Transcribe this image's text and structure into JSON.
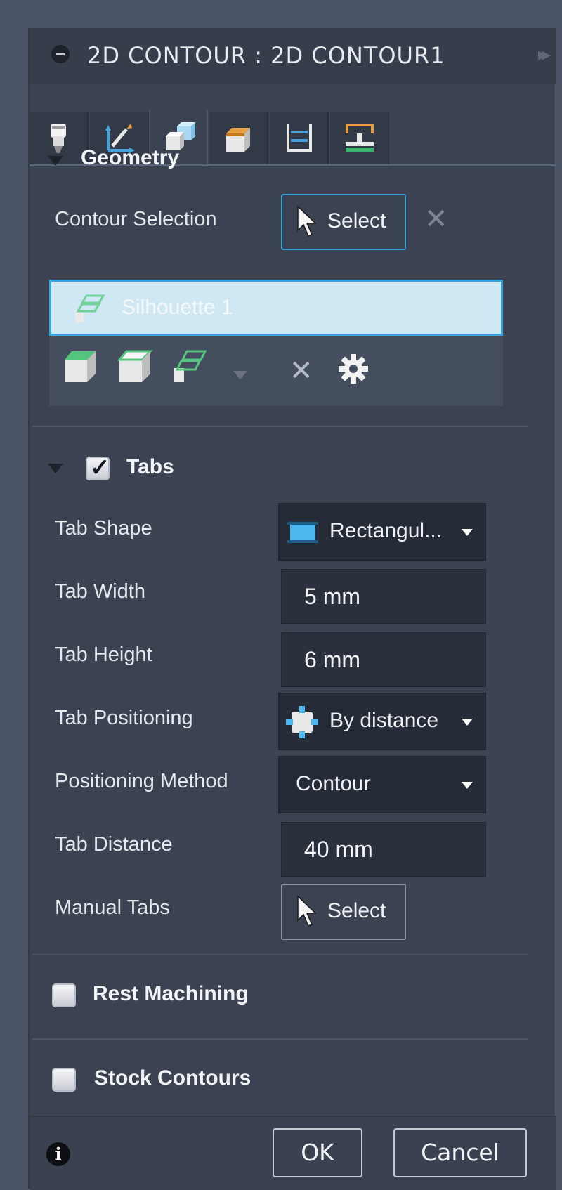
{
  "window": {
    "title": "2D CONTOUR : 2D CONTOUR1"
  },
  "tabs": [
    {
      "name": "tool-tab",
      "icon": "tool-icon"
    },
    {
      "name": "heights-tab",
      "icon": "axes-pencil-icon"
    },
    {
      "name": "geometry-tab",
      "icon": "geometry-cube-icon"
    },
    {
      "name": "stock-tab",
      "icon": "stock-cube-icon"
    },
    {
      "name": "passes-tab",
      "icon": "passes-icon"
    },
    {
      "name": "linking-tab",
      "icon": "linking-icon"
    }
  ],
  "geometry": {
    "title": "Geometry",
    "contour_selection_label": "Contour Selection",
    "select_label": "Select",
    "selected_item": "Silhouette 1"
  },
  "tabs_section": {
    "title": "Tabs",
    "enabled": true,
    "tab_shape_label": "Tab Shape",
    "tab_shape_value": "Rectangul...",
    "tab_width_label": "Tab Width",
    "tab_width_value": "5 mm",
    "tab_height_label": "Tab Height",
    "tab_height_value": "6 mm",
    "tab_positioning_label": "Tab Positioning",
    "tab_positioning_value": "By distance",
    "positioning_method_label": "Positioning Method",
    "positioning_method_value": "Contour",
    "tab_distance_label": "Tab Distance",
    "tab_distance_value": "40 mm",
    "manual_tabs_label": "Manual Tabs",
    "manual_select_label": "Select"
  },
  "rest_machining": {
    "title": "Rest Machining",
    "enabled": false
  },
  "stock_contours": {
    "title": "Stock Contours",
    "enabled": false
  },
  "footer": {
    "info": "i",
    "ok_label": "OK",
    "cancel_label": "Cancel"
  },
  "colors": {
    "accent": "#36a6e0",
    "panel_bg": "#3b4352",
    "field_bg": "#2a313d"
  }
}
